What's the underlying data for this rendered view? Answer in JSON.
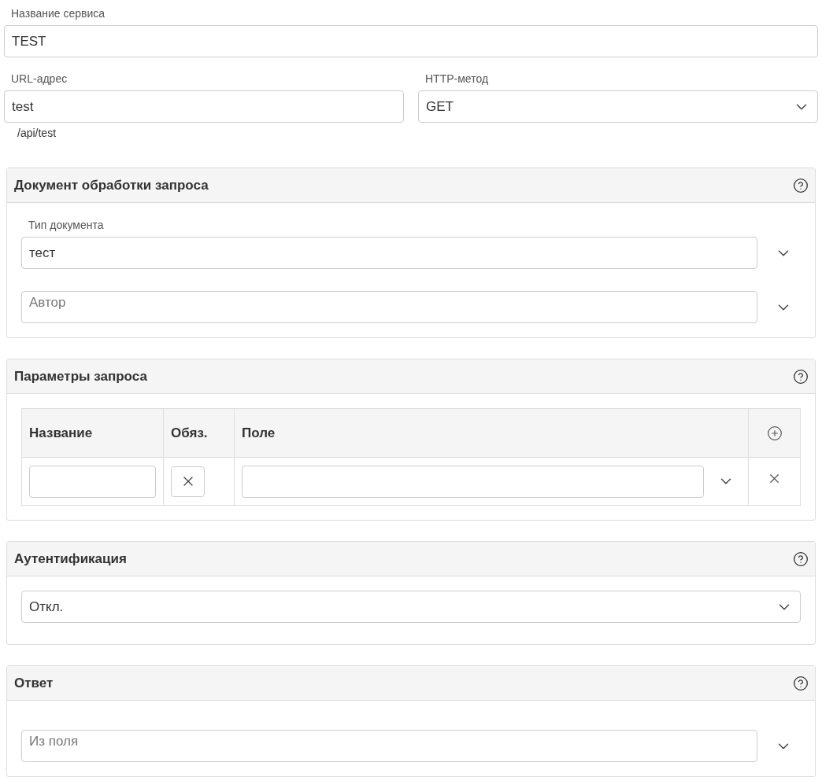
{
  "service_name": {
    "label": "Название сервиса",
    "value": "TEST"
  },
  "url": {
    "label": "URL-адрес",
    "value": "test",
    "hint": "/api/test"
  },
  "http_method": {
    "label": "HTTP-метод",
    "value": "GET"
  },
  "sections": [
    {
      "kind": "fields",
      "title": "Документ обработки запроса",
      "fields": [
        {
          "label": "Тип документа",
          "value": "тест"
        },
        {
          "placeholder": "Автор"
        }
      ]
    },
    {
      "kind": "table",
      "title": "Параметры запроса",
      "columns": [
        "Название",
        "Обяз.",
        "Поле"
      ],
      "rows": [
        {
          "required": false
        }
      ]
    },
    {
      "kind": "select",
      "title": "Аутентификация",
      "value": "Откл."
    },
    {
      "kind": "fields",
      "title": "Ответ",
      "fields": [
        {
          "placeholder": "Из поля"
        }
      ]
    }
  ]
}
